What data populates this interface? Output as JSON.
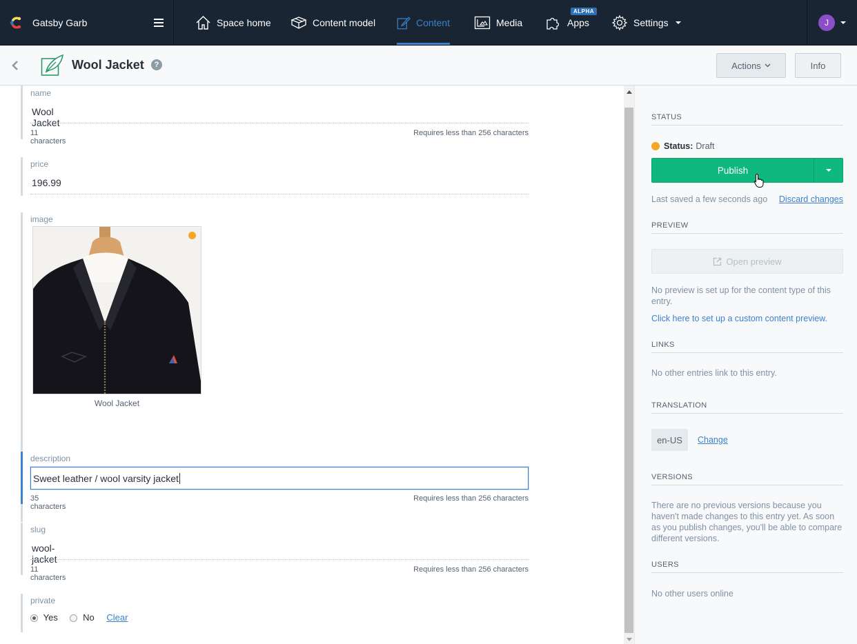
{
  "topnav": {
    "space_name": "Gatsby Garb",
    "items": [
      {
        "label": "Space home",
        "icon": "home-icon"
      },
      {
        "label": "Content model",
        "icon": "content-model-icon"
      },
      {
        "label": "Content",
        "icon": "content-icon",
        "active": true
      },
      {
        "label": "Media",
        "icon": "media-icon"
      },
      {
        "label": "Apps",
        "icon": "apps-icon",
        "badge": "ALPHA"
      },
      {
        "label": "Settings",
        "icon": "gear-icon"
      }
    ],
    "user_initial": "J"
  },
  "entry": {
    "title": "Wool Jacket",
    "help": "?",
    "actions_label": "Actions",
    "info_label": "Info"
  },
  "fields": {
    "name": {
      "label": "name",
      "value": "Wool Jacket",
      "count": "11 characters",
      "req": "Requires less than 256 characters"
    },
    "price": {
      "label": "price",
      "value": "196.99"
    },
    "image": {
      "label": "image",
      "caption": "Wool Jacket"
    },
    "description": {
      "label": "description",
      "value": "Sweet leather / wool varsity jacket",
      "count": "35 characters",
      "req": "Requires less than 256 characters"
    },
    "slug": {
      "label": "slug",
      "value": "wool-jacket",
      "count": "11 characters",
      "req": "Requires less than 256 characters"
    },
    "private": {
      "label": "private",
      "yes": "Yes",
      "no": "No",
      "clear": "Clear",
      "selected": "Yes"
    }
  },
  "sidebar": {
    "status_heading": "STATUS",
    "status_label": "Status:",
    "status_value": "Draft",
    "status_color": "#f5a623",
    "publish_label": "Publish",
    "last_saved": "Last saved a few seconds ago",
    "discard": "Discard changes",
    "preview_heading": "PREVIEW",
    "open_preview": "Open preview",
    "preview_note": "No preview is set up for the content type of this entry.",
    "preview_link": "Click here to set up a custom content preview.",
    "links_heading": "LINKS",
    "links_text": "No other entries link to this entry.",
    "translation_heading": "TRANSLATION",
    "locale": "en-US",
    "change": "Change",
    "versions_heading": "VERSIONS",
    "versions_text": "There are no previous versions because you haven't made changes to this entry yet. As soon as you publish changes, you'll be able to compare different versions.",
    "users_heading": "USERS",
    "users_text": "No other users online"
  },
  "colors": {
    "nav_bg": "#192532",
    "accent": "#3c80cf",
    "publish": "#0eb87f"
  }
}
